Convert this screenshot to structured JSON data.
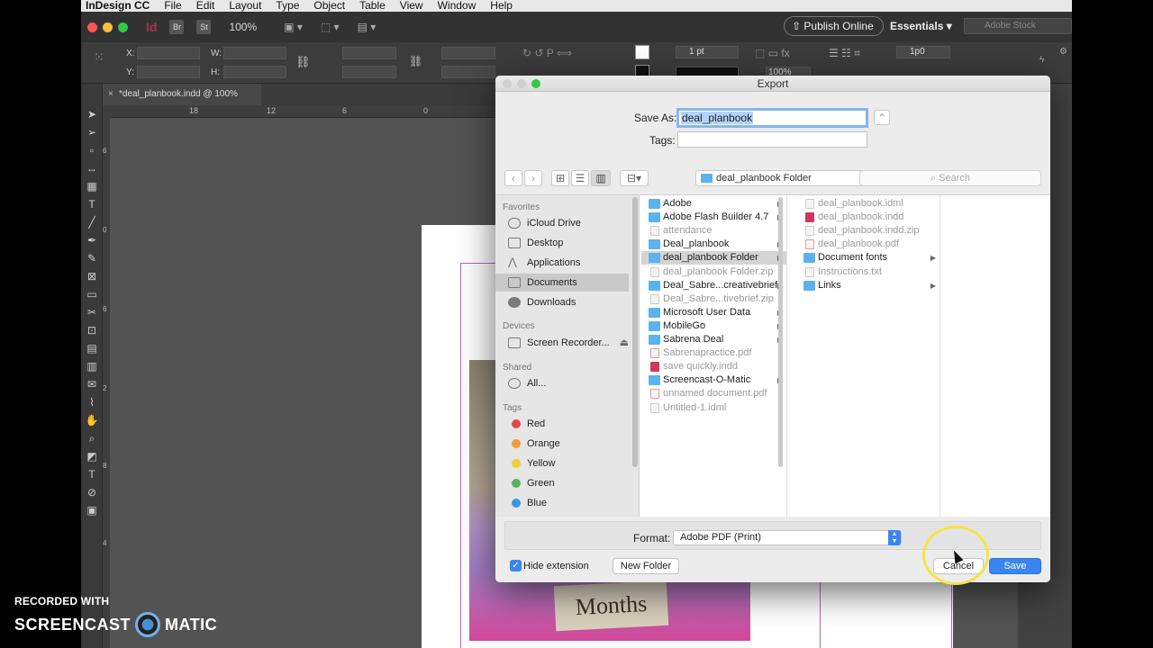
{
  "menubar": {
    "app": "InDesign CC",
    "items": [
      "File",
      "Edit",
      "Layout",
      "Type",
      "Object",
      "Table",
      "View",
      "Window",
      "Help"
    ]
  },
  "appbar": {
    "logo": "Id",
    "bridge": "Br",
    "stock_app": "St",
    "zoom": "100%",
    "publish": "Publish Online",
    "workspace": "Essentials",
    "stock_search_placeholder": "Adobe Stock"
  },
  "control": {
    "x_label": "X:",
    "y_label": "Y:",
    "w_label": "W:",
    "h_label": "H:",
    "stroke": "1 pt",
    "scale": "100%",
    "spacing": "1p0"
  },
  "document": {
    "tab_title": "*deal_planbook.indd @ 100%",
    "ruler_h": [
      "18",
      "12",
      "6",
      "0"
    ],
    "ruler_v": [
      "6",
      "0",
      "6",
      "2",
      "8",
      "4"
    ],
    "photo_sign": "Months"
  },
  "dialog": {
    "title": "Export",
    "save_as_label": "Save As:",
    "save_as_value": "deal_planbook",
    "tags_label": "Tags:",
    "path": "deal_planbook Folder",
    "search_placeholder": "Search",
    "sidebar": {
      "favorites_head": "Favorites",
      "favorites": [
        "iCloud Drive",
        "Desktop",
        "Applications",
        "Documents",
        "Downloads"
      ],
      "devices_head": "Devices",
      "devices": [
        "Screen Recorder..."
      ],
      "shared_head": "Shared",
      "shared": [
        "All..."
      ],
      "tags_head": "Tags",
      "tags": [
        {
          "name": "Red",
          "color": "#e4474b"
        },
        {
          "name": "Orange",
          "color": "#f29b35"
        },
        {
          "name": "Yellow",
          "color": "#f1cb3a"
        },
        {
          "name": "Green",
          "color": "#52b55a"
        },
        {
          "name": "Blue",
          "color": "#3a95e6"
        }
      ]
    },
    "column1": [
      {
        "name": "Adobe",
        "kind": "folder",
        "dim": false,
        "arrow": true
      },
      {
        "name": "Adobe Flash Builder 4.7",
        "kind": "folder",
        "dim": false,
        "arrow": true
      },
      {
        "name": "attendance",
        "kind": "file",
        "dim": true,
        "arrow": false
      },
      {
        "name": "Deal_planbook",
        "kind": "folder",
        "dim": false,
        "arrow": true
      },
      {
        "name": "deal_planbook Folder",
        "kind": "folder",
        "dim": false,
        "arrow": true,
        "selected": true
      },
      {
        "name": "deal_planbook Folder.zip",
        "kind": "file",
        "dim": true,
        "arrow": false
      },
      {
        "name": "Deal_Sabre...creativebrief",
        "kind": "folder",
        "dim": false,
        "arrow": true
      },
      {
        "name": "Deal_Sabre...tivebrief.zip",
        "kind": "file",
        "dim": true,
        "arrow": false
      },
      {
        "name": "Microsoft User Data",
        "kind": "folder",
        "dim": false,
        "arrow": true
      },
      {
        "name": "MobileGo",
        "kind": "folder",
        "dim": false,
        "arrow": true
      },
      {
        "name": "Sabrena Deal",
        "kind": "folder",
        "dim": false,
        "arrow": true
      },
      {
        "name": "Sabrenapractice.pdf",
        "kind": "pdf",
        "dim": true,
        "arrow": false
      },
      {
        "name": "save quickly.indd",
        "kind": "indd",
        "dim": true,
        "arrow": false
      },
      {
        "name": "Screencast-O-Matic",
        "kind": "folder",
        "dim": false,
        "arrow": true
      },
      {
        "name": "unnamed document.pdf",
        "kind": "pdf",
        "dim": true,
        "arrow": false
      },
      {
        "name": "Untitled-1.idml",
        "kind": "file",
        "dim": true,
        "arrow": false
      }
    ],
    "column2": [
      {
        "name": "deal_planbook.idml",
        "kind": "file",
        "dim": true,
        "arrow": false
      },
      {
        "name": "deal_planbook.indd",
        "kind": "indd",
        "dim": true,
        "arrow": false
      },
      {
        "name": "deal_planbook.indd.zip",
        "kind": "file",
        "dim": true,
        "arrow": false
      },
      {
        "name": "deal_planbook.pdf",
        "kind": "pdf",
        "dim": true,
        "arrow": false
      },
      {
        "name": "Document fonts",
        "kind": "folder",
        "dim": false,
        "arrow": true
      },
      {
        "name": "Instructions.txt",
        "kind": "file",
        "dim": true,
        "arrow": false
      },
      {
        "name": "Links",
        "kind": "folder",
        "dim": false,
        "arrow": true
      }
    ],
    "format_label": "Format:",
    "format_value": "Adobe PDF (Print)",
    "hide_extension": "Hide extension",
    "hide_extension_checked": true,
    "new_folder": "New Folder",
    "cancel": "Cancel",
    "save": "Save"
  },
  "watermark": {
    "line1": "RECORDED WITH",
    "left": "SCREENCAST",
    "right": "MATIC"
  }
}
